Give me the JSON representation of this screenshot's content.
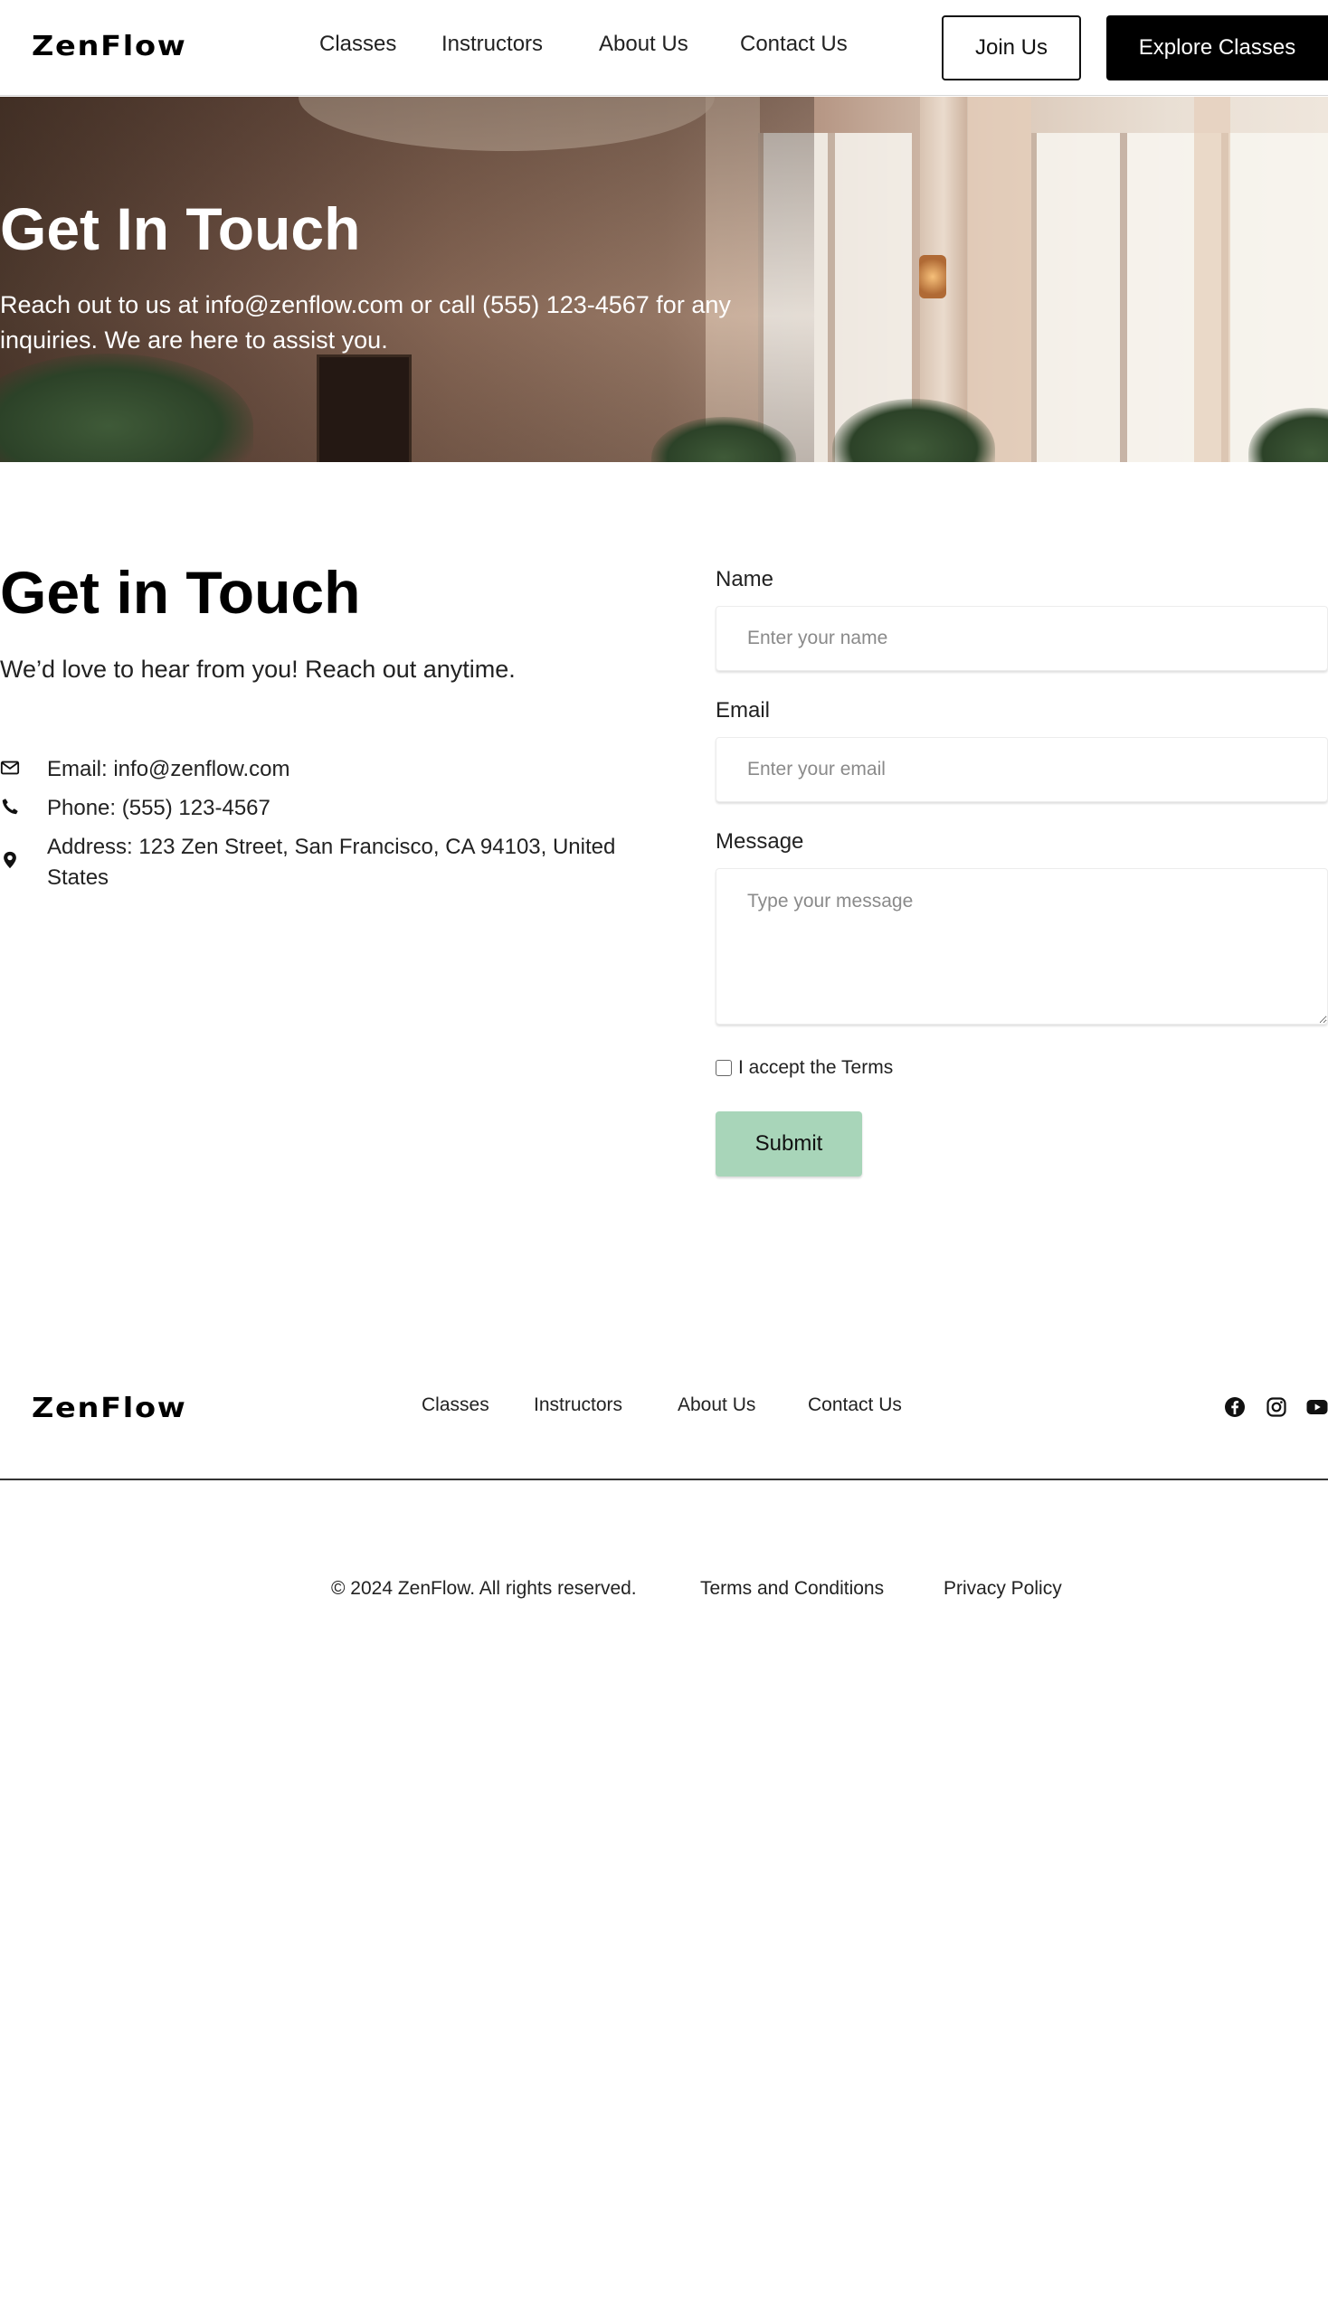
{
  "brand": {
    "logo": "ZenFlow"
  },
  "header": {
    "nav": [
      "Classes",
      "Instructors",
      "About Us",
      "Contact Us"
    ],
    "join_label": "Join Us",
    "explore_label": "Explore Classes"
  },
  "hero": {
    "title": "Get In Touch",
    "subtitle": "Reach out to us at info@zenflow.com or call (555) 123-4567 for any inquiries. We are here to assist you."
  },
  "contact": {
    "title": "Get in Touch",
    "subtitle": "We’d love to hear from you! Reach out anytime.",
    "info": [
      {
        "icon": "envelope-icon",
        "text": "Email: info@zenflow.com"
      },
      {
        "icon": "phone-icon",
        "text": "Phone: (555) 123-4567"
      },
      {
        "icon": "location-pin-icon",
        "text": "Address: 123 Zen Street, San Francisco, CA 94103, United States"
      }
    ]
  },
  "form": {
    "name_label": "Name",
    "name_placeholder": "Enter your name",
    "email_label": "Email",
    "email_placeholder": "Enter your email",
    "message_label": "Message",
    "message_placeholder": "Type your message",
    "terms_label": "I accept the Terms",
    "submit_label": "Submit",
    "submit_color": "#a8d5b9"
  },
  "footer": {
    "logo": "ZenFlow",
    "nav": [
      "Classes",
      "Instructors",
      "About Us",
      "Contact Us"
    ],
    "social_icons": [
      "facebook-icon",
      "instagram-icon",
      "youtube-icon"
    ],
    "copyright": "© 2024 ZenFlow. All rights reserved.",
    "terms_link": "Terms and Conditions",
    "privacy_link": "Privacy Policy"
  }
}
